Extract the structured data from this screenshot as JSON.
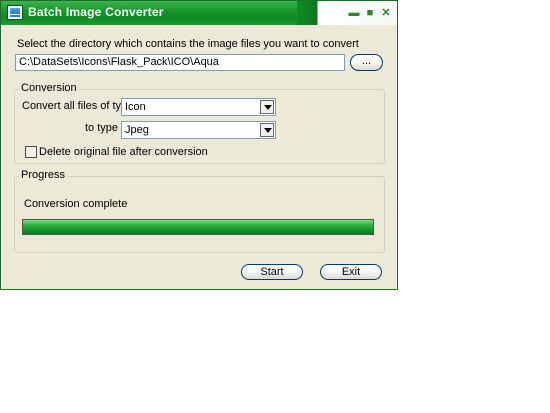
{
  "window": {
    "title": "Batch Image Converter",
    "minimize_glyph": "▬",
    "maximize_glyph": "■",
    "close_glyph": "✕"
  },
  "directory": {
    "prompt": "Select the directory which contains the image files you want to convert",
    "path": "C:\\DataSets\\Icons\\Flask_Pack\\ICO\\Aqua",
    "browse_label": "..."
  },
  "conversion": {
    "group_title": "Conversion",
    "from_label": "Convert all files of type",
    "from_value": "Icon",
    "to_label": "to type",
    "to_value": "Jpeg",
    "delete_label": "Delete original file after conversion",
    "delete_checked": false
  },
  "progress": {
    "group_title": "Progress",
    "status": "Conversion complete",
    "fraction": 1.0
  },
  "buttons": {
    "start_label": "Start",
    "exit_label": "Exit"
  },
  "colors": {
    "titlebar": "#16952a",
    "progress_fill": "#159432",
    "dialog_bg": "#ece9d8"
  }
}
